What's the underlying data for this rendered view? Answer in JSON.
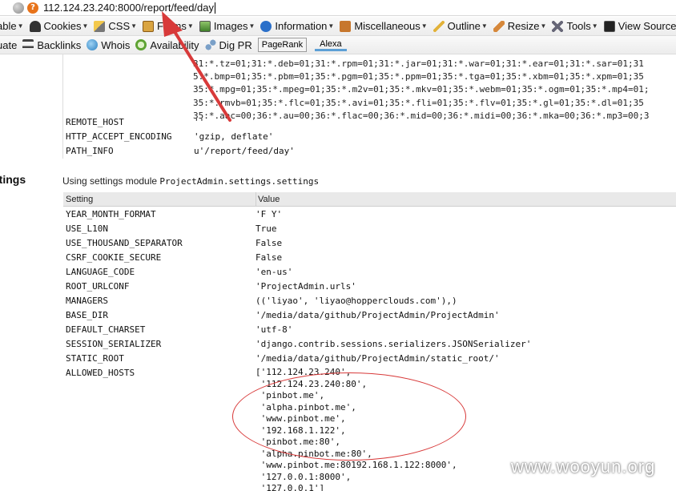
{
  "address_bar": {
    "url": "112.124.23.240:8000/report/feed/day"
  },
  "toolbar1": {
    "items": [
      {
        "label": "able",
        "icon": "table-icon"
      },
      {
        "label": "Cookies",
        "icon": "user-icon"
      },
      {
        "label": "CSS",
        "icon": "pencil-icon"
      },
      {
        "label": "Forms",
        "icon": "clipboard-icon"
      },
      {
        "label": "Images",
        "icon": "image-icon"
      },
      {
        "label": "Information",
        "icon": "info-icon"
      },
      {
        "label": "Miscellaneous",
        "icon": "book-icon"
      },
      {
        "label": "Outline",
        "icon": "pen-icon"
      },
      {
        "label": "Resize",
        "icon": "ruler-icon"
      },
      {
        "label": "Tools",
        "icon": "tools-icon"
      },
      {
        "label": "View Source",
        "icon": "monitor-icon"
      }
    ]
  },
  "toolbar2": {
    "items": [
      {
        "label": "uate",
        "icon": ""
      },
      {
        "label": "Backlinks",
        "icon": "arrows-icon"
      },
      {
        "label": "Whois",
        "icon": "globe-icon"
      },
      {
        "label": "Availability",
        "icon": "search-icon"
      },
      {
        "label": "Dig PR",
        "icon": "network-icon"
      }
    ],
    "pagerank_label": "PageRank",
    "alexa_label": "Alexa"
  },
  "section_heading": "ttings",
  "env": {
    "value_lines": [
      "31:*.tz=01;31:*.deb=01;31:*.rpm=01;31:*.jar=01;31:*.war=01;31:*.ear=01;31:*.sar=01;31",
      "5:*.bmp=01;35:*.pbm=01;35:*.pgm=01;35:*.ppm=01;35:*.tga=01;35:*.xbm=01;35:*.xpm=01;35",
      "35:*.mpg=01;35:*.mpeg=01;35:*.m2v=01;35:*.mkv=01;35:*.webm=01;35:*.ogm=01;35:*.mp4=01;",
      "35:*.rmvb=01;35:*.flc=01;35:*.avi=01;35:*.fli=01;35:*.flv=01;35:*.gl=01;35:*.dl=01;35",
      "35:*.aac=00;36:*.au=00;36:*.flac=00;36:*.mid=00;36:*.midi=00;36:*.mka=00;36:*.mp3=00;3"
    ],
    "rows": [
      {
        "key": "REMOTE_HOST",
        "value": "''"
      },
      {
        "key": "HTTP_ACCEPT_ENCODING",
        "value": "'gzip, deflate'"
      },
      {
        "key": "PATH_INFO",
        "value": "u'/report/feed/day'"
      }
    ]
  },
  "settings": {
    "intro": "Using settings module ",
    "module": "ProjectAdmin.settings.settings",
    "col_setting": "Setting",
    "col_value": "Value",
    "rows": [
      {
        "key": "YEAR_MONTH_FORMAT",
        "value": "'F Y'"
      },
      {
        "key": "USE_L10N",
        "value": "True"
      },
      {
        "key": "USE_THOUSAND_SEPARATOR",
        "value": "False"
      },
      {
        "key": "CSRF_COOKIE_SECURE",
        "value": "False"
      },
      {
        "key": "LANGUAGE_CODE",
        "value": "'en-us'"
      },
      {
        "key": "ROOT_URLCONF",
        "value": "'ProjectAdmin.urls'"
      },
      {
        "key": "MANAGERS",
        "value": "(('liyao', 'liyao@hopperclouds.com'),)"
      },
      {
        "key": "BASE_DIR",
        "value": "'/media/data/github/ProjectAdmin/ProjectAdmin'"
      },
      {
        "key": "DEFAULT_CHARSET",
        "value": "'utf-8'"
      },
      {
        "key": "SESSION_SERIALIZER",
        "value": "'django.contrib.sessions.serializers.JSONSerializer'"
      },
      {
        "key": "STATIC_ROOT",
        "value": "'/media/data/github/ProjectAdmin/static_root/'"
      },
      {
        "key": "ALLOWED_HOSTS",
        "value": ""
      }
    ],
    "allowed_hosts_lines": [
      "['112.124.23.240',",
      " '112.124.23.240:80',",
      " 'pinbot.me',",
      " 'alpha.pinbot.me',",
      " 'www.pinbot.me',",
      " '192.168.1.122',",
      " 'pinbot.me:80',",
      " 'alpha.pinbot.me:80',",
      " 'www.pinbot.me:80192.168.1.122:8000',",
      " '127.0.0.1:8000',",
      " '127.0.0.1']"
    ]
  },
  "watermark": "www.wooyun.org",
  "colors": {
    "annotation": "#d83a3a",
    "toolbar_bg": "#ececec",
    "header_bg": "#e9e9e9"
  }
}
